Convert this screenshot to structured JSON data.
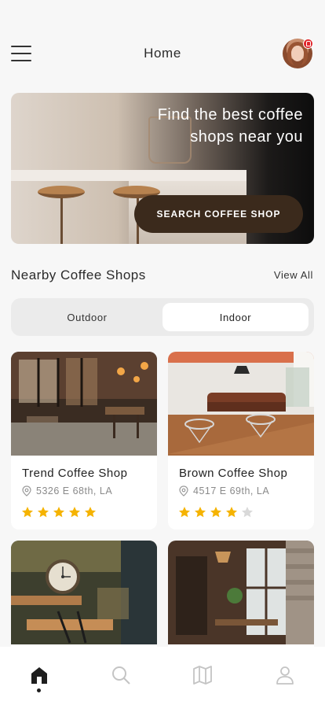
{
  "header": {
    "title": "Home",
    "menu_icon": "hamburger-menu-icon",
    "avatar_icon": "user-avatar",
    "notification_icon": "lock-badge-icon",
    "notification_color": "#e0262c"
  },
  "hero": {
    "headline": "Find the best coffee shops near you",
    "button_label": "SEARCH COFFEE SHOP",
    "button_color": "#3b2a1c"
  },
  "nearby": {
    "title": "Nearby Coffee Shops",
    "view_all_label": "View All"
  },
  "filter": {
    "options": [
      "Outdoor",
      "Indoor"
    ],
    "selected": "Indoor"
  },
  "shops": [
    {
      "name": "Trend Coffee Shop",
      "address": "5326 E 68th, LA",
      "rating": 5
    },
    {
      "name": "Brown Coffee Shop",
      "address": "4517 E 69th, LA",
      "rating": 4
    },
    {
      "name": "",
      "address": "",
      "rating": null
    },
    {
      "name": "",
      "address": "",
      "rating": null
    }
  ],
  "tabbar": {
    "items": [
      {
        "icon": "home-icon",
        "active": true
      },
      {
        "icon": "search-icon",
        "active": false
      },
      {
        "icon": "map-icon",
        "active": false
      },
      {
        "icon": "profile-icon",
        "active": false
      }
    ]
  },
  "colors": {
    "star_active": "#f5b301",
    "star_inactive": "#d9d9d9",
    "accent_dark": "#3b2a1c",
    "background": "#f7f7f7"
  }
}
